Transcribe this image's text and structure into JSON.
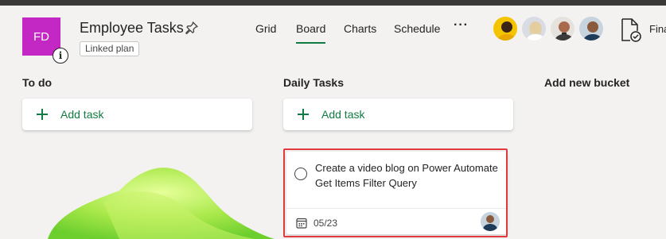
{
  "plan": {
    "initials": "FD",
    "title": "Employee Tasks",
    "badge": "Linked plan",
    "tile_color": "#c428c4"
  },
  "nav": {
    "tabs": [
      {
        "label": "Grid",
        "active": false
      },
      {
        "label": "Board",
        "active": true
      },
      {
        "label": "Charts",
        "active": false
      },
      {
        "label": "Schedule",
        "active": false
      }
    ],
    "more_label": "···",
    "accent_color": "#107c41"
  },
  "header_right": {
    "members": [
      "member-avatar-1",
      "member-avatar-2",
      "member-avatar-3",
      "member-avatar-4"
    ],
    "file_label": "Fina"
  },
  "buckets": [
    {
      "title": "To do",
      "add_task_label": "Add task"
    },
    {
      "title": "Daily Tasks",
      "add_task_label": "Add task"
    },
    {
      "title": "Add new bucket"
    }
  ],
  "task": {
    "title": "Create a video blog on Power Automate Get Items Filter Query",
    "due_date": "05/23",
    "highlight_color": "#e0393e"
  }
}
